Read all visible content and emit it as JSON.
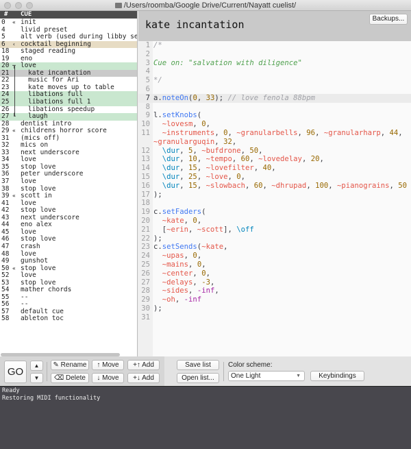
{
  "window": {
    "title": "/Users/roomba/Google Drive/Current/Nayatt cuelist/"
  },
  "cuelist": {
    "headers": {
      "num": "#",
      "cue": "CUE"
    },
    "rows": [
      {
        "num": "0",
        "mark": "«",
        "name": "init"
      },
      {
        "num": "4",
        "mark": "",
        "name": "livid preset"
      },
      {
        "num": "5",
        "mark": "",
        "name": "alt verb (used during libby section)"
      },
      {
        "num": "6",
        "mark": "‹",
        "name": "cocktail beginning",
        "state": "tan"
      },
      {
        "num": "18",
        "mark": "",
        "name": "staged reading"
      },
      {
        "num": "19",
        "mark": "",
        "name": "eno"
      },
      {
        "num": "20",
        "mark": "┬",
        "name": "love",
        "state": "green"
      },
      {
        "num": "21",
        "mark": "",
        "name": "kate incantation",
        "state": "sel",
        "indent": true
      },
      {
        "num": "22",
        "mark": "",
        "name": "music for Ari",
        "indent": true
      },
      {
        "num": "23",
        "mark": "",
        "name": "kate moves up to table",
        "indent": true
      },
      {
        "num": "24",
        "mark": "",
        "name": "libations full",
        "state": "green",
        "indent": true
      },
      {
        "num": "25",
        "mark": "",
        "name": "libations full 1",
        "state": "green",
        "indent": true
      },
      {
        "num": "26",
        "mark": "",
        "name": "libations speedup",
        "indent": true
      },
      {
        "num": "27",
        "mark": "└",
        "name": "laugh",
        "state": "green",
        "indent": true
      },
      {
        "num": "28",
        "mark": "",
        "name": "dentist intro"
      },
      {
        "num": "29",
        "mark": "«",
        "name": "childrens horror score"
      },
      {
        "num": "31",
        "mark": "",
        "name": "(mics off)"
      },
      {
        "num": "32",
        "mark": "",
        "name": "mics on"
      },
      {
        "num": "33",
        "mark": "",
        "name": "next underscore"
      },
      {
        "num": "34",
        "mark": "",
        "name": "love"
      },
      {
        "num": "35",
        "mark": "",
        "name": "stop love"
      },
      {
        "num": "36",
        "mark": "",
        "name": "peter underscore"
      },
      {
        "num": "37",
        "mark": "",
        "name": "love"
      },
      {
        "num": "38",
        "mark": "",
        "name": "stop love"
      },
      {
        "num": "39",
        "mark": "«",
        "name": "scott in"
      },
      {
        "num": "41",
        "mark": "",
        "name": "love"
      },
      {
        "num": "42",
        "mark": "",
        "name": "stop love"
      },
      {
        "num": "43",
        "mark": "",
        "name": "next underscore"
      },
      {
        "num": "44",
        "mark": "",
        "name": "eno alex"
      },
      {
        "num": "45",
        "mark": "",
        "name": "love"
      },
      {
        "num": "46",
        "mark": "",
        "name": "stop love"
      },
      {
        "num": "47",
        "mark": "",
        "name": "crash"
      },
      {
        "num": "48",
        "mark": "",
        "name": "love"
      },
      {
        "num": "49",
        "mark": "",
        "name": "gunshot"
      },
      {
        "num": "50",
        "mark": "«",
        "name": "stop love"
      },
      {
        "num": "52",
        "mark": "",
        "name": "love"
      },
      {
        "num": "53",
        "mark": "",
        "name": "stop love"
      },
      {
        "num": "54",
        "mark": "",
        "name": "mather chords"
      },
      {
        "num": "55",
        "mark": "",
        "name": "--"
      },
      {
        "num": "56",
        "mark": "",
        "name": "--"
      },
      {
        "num": "57",
        "mark": "",
        "name": "default cue"
      },
      {
        "num": "58",
        "mark": "",
        "name": "ableton toc"
      }
    ]
  },
  "editor": {
    "cue_title": "kate incantation",
    "backups_label": "Backups...",
    "current_line": "7",
    "lines": [
      {
        "n": "1",
        "t": [
          [
            "cm",
            "/*"
          ]
        ]
      },
      {
        "n": "2",
        "t": []
      },
      {
        "n": "3",
        "t": [
          [
            "cg",
            "Cue on: \"salvation with diligence\""
          ]
        ]
      },
      {
        "n": "4",
        "t": []
      },
      {
        "n": "5",
        "t": [
          [
            "cm",
            "*/"
          ]
        ]
      },
      {
        "n": "6",
        "t": []
      },
      {
        "n": "7",
        "t": [
          [
            "p",
            "a."
          ],
          [
            "fn",
            "noteOn"
          ],
          [
            "p",
            "("
          ],
          [
            "num",
            "0"
          ],
          [
            "p",
            ", "
          ],
          [
            "num",
            "33"
          ],
          [
            "p",
            "); "
          ],
          [
            "cm",
            "// love fenola 88bpm"
          ]
        ]
      },
      {
        "n": "8",
        "t": []
      },
      {
        "n": "9",
        "t": [
          [
            "p",
            "l."
          ],
          [
            "fn",
            "setKnobs"
          ],
          [
            "p",
            "("
          ]
        ]
      },
      {
        "n": "10",
        "t": [
          [
            "p",
            "  "
          ],
          [
            "var",
            "~lovesm"
          ],
          [
            "p",
            ", "
          ],
          [
            "num",
            "0"
          ],
          [
            "p",
            ","
          ]
        ]
      },
      {
        "n": "11",
        "t": [
          [
            "p",
            "  "
          ],
          [
            "var",
            "~instruments"
          ],
          [
            "p",
            ", "
          ],
          [
            "num",
            "0"
          ],
          [
            "p",
            ", "
          ],
          [
            "var",
            "~granularbells"
          ],
          [
            "p",
            ", "
          ],
          [
            "num",
            "96"
          ],
          [
            "p",
            ", "
          ],
          [
            "var",
            "~granularharp"
          ],
          [
            "p",
            ", "
          ],
          [
            "num",
            "44"
          ],
          [
            "p",
            ","
          ]
        ]
      },
      {
        "n": "",
        "t": [
          [
            "var",
            "~granularguqin"
          ],
          [
            "p",
            ", "
          ],
          [
            "num",
            "32"
          ],
          [
            "p",
            ","
          ]
        ]
      },
      {
        "n": "12",
        "t": [
          [
            "p",
            "  "
          ],
          [
            "sym",
            "\\dur"
          ],
          [
            "p",
            ", "
          ],
          [
            "num",
            "5"
          ],
          [
            "p",
            ", "
          ],
          [
            "var",
            "~bufdrone"
          ],
          [
            "p",
            ", "
          ],
          [
            "num",
            "50"
          ],
          [
            "p",
            ","
          ]
        ]
      },
      {
        "n": "13",
        "t": [
          [
            "p",
            "  "
          ],
          [
            "sym",
            "\\dur"
          ],
          [
            "p",
            ", "
          ],
          [
            "num",
            "10"
          ],
          [
            "p",
            ", "
          ],
          [
            "var",
            "~tempo"
          ],
          [
            "p",
            ", "
          ],
          [
            "num",
            "60"
          ],
          [
            "p",
            ", "
          ],
          [
            "var",
            "~lovedelay"
          ],
          [
            "p",
            ", "
          ],
          [
            "num",
            "20"
          ],
          [
            "p",
            ","
          ]
        ]
      },
      {
        "n": "14",
        "t": [
          [
            "p",
            "  "
          ],
          [
            "sym",
            "\\dur"
          ],
          [
            "p",
            ", "
          ],
          [
            "num",
            "15"
          ],
          [
            "p",
            ", "
          ],
          [
            "var",
            "~lovefilter"
          ],
          [
            "p",
            ", "
          ],
          [
            "num",
            "40"
          ],
          [
            "p",
            ","
          ]
        ]
      },
      {
        "n": "15",
        "t": [
          [
            "p",
            "  "
          ],
          [
            "sym",
            "\\dur"
          ],
          [
            "p",
            ", "
          ],
          [
            "num",
            "25"
          ],
          [
            "p",
            ", "
          ],
          [
            "var",
            "~love"
          ],
          [
            "p",
            ", "
          ],
          [
            "num",
            "0"
          ],
          [
            "p",
            ","
          ]
        ]
      },
      {
        "n": "16",
        "t": [
          [
            "p",
            "  "
          ],
          [
            "sym",
            "\\dur"
          ],
          [
            "p",
            ", "
          ],
          [
            "num",
            "15"
          ],
          [
            "p",
            ", "
          ],
          [
            "var",
            "~slowbach"
          ],
          [
            "p",
            ", "
          ],
          [
            "num",
            "60"
          ],
          [
            "p",
            ", "
          ],
          [
            "var",
            "~dhrupad"
          ],
          [
            "p",
            ", "
          ],
          [
            "num",
            "100"
          ],
          [
            "p",
            ", "
          ],
          [
            "var",
            "~pianograins"
          ],
          [
            "p",
            ", "
          ],
          [
            "num",
            "50"
          ]
        ]
      },
      {
        "n": "17",
        "t": [
          [
            "p",
            ");"
          ]
        ]
      },
      {
        "n": "18",
        "t": []
      },
      {
        "n": "19",
        "t": [
          [
            "p",
            "c."
          ],
          [
            "fn",
            "setFaders"
          ],
          [
            "p",
            "("
          ]
        ]
      },
      {
        "n": "20",
        "t": [
          [
            "p",
            "  "
          ],
          [
            "var",
            "~kate"
          ],
          [
            "p",
            ", "
          ],
          [
            "num",
            "0"
          ],
          [
            "p",
            ","
          ]
        ]
      },
      {
        "n": "21",
        "t": [
          [
            "p",
            "  ["
          ],
          [
            "var",
            "~erin"
          ],
          [
            "p",
            ", "
          ],
          [
            "var",
            "~scott"
          ],
          [
            "p",
            "], "
          ],
          [
            "sym",
            "\\off"
          ]
        ]
      },
      {
        "n": "22",
        "t": [
          [
            "p",
            ");"
          ]
        ]
      },
      {
        "n": "23",
        "t": [
          [
            "p",
            "c."
          ],
          [
            "fn",
            "setSends"
          ],
          [
            "p",
            "("
          ],
          [
            "var",
            "~kate"
          ],
          [
            "p",
            ","
          ]
        ]
      },
      {
        "n": "24",
        "t": [
          [
            "p",
            "  "
          ],
          [
            "var",
            "~upas"
          ],
          [
            "p",
            ", "
          ],
          [
            "num",
            "0"
          ],
          [
            "p",
            ","
          ]
        ]
      },
      {
        "n": "25",
        "t": [
          [
            "p",
            "  "
          ],
          [
            "var",
            "~mains"
          ],
          [
            "p",
            ", "
          ],
          [
            "num",
            "0"
          ],
          [
            "p",
            ","
          ]
        ]
      },
      {
        "n": "26",
        "t": [
          [
            "p",
            "  "
          ],
          [
            "var",
            "~center"
          ],
          [
            "p",
            ", "
          ],
          [
            "num",
            "0"
          ],
          [
            "p",
            ","
          ]
        ]
      },
      {
        "n": "27",
        "t": [
          [
            "p",
            "  "
          ],
          [
            "var",
            "~delays"
          ],
          [
            "p",
            ", "
          ],
          [
            "num",
            "-3"
          ],
          [
            "p",
            ","
          ]
        ]
      },
      {
        "n": "28",
        "t": [
          [
            "p",
            "  "
          ],
          [
            "var",
            "~sides"
          ],
          [
            "p",
            ", "
          ],
          [
            "kw",
            "-inf"
          ],
          [
            "p",
            ","
          ]
        ]
      },
      {
        "n": "29",
        "t": [
          [
            "p",
            "  "
          ],
          [
            "var",
            "~oh"
          ],
          [
            "p",
            ", "
          ],
          [
            "kw",
            "-inf"
          ]
        ]
      },
      {
        "n": "30",
        "t": [
          [
            "p",
            ");"
          ]
        ]
      },
      {
        "n": "31",
        "t": []
      }
    ]
  },
  "toolbar": {
    "go": "GO",
    "up": "▲",
    "down": "▼",
    "rename": "✎ Rename",
    "delete": "⌫ Delete",
    "move_up": "↑ Move",
    "move_down": "↓ Move",
    "add_above": "+↑ Add",
    "add_below": "+↓ Add",
    "save": "Save list",
    "open": "Open list...",
    "scheme_label": "Color scheme:",
    "scheme_value": "One Light",
    "keybindings": "Keybindings"
  },
  "console": {
    "lines": [
      "Ready",
      "Restoring MIDI functionality"
    ]
  }
}
